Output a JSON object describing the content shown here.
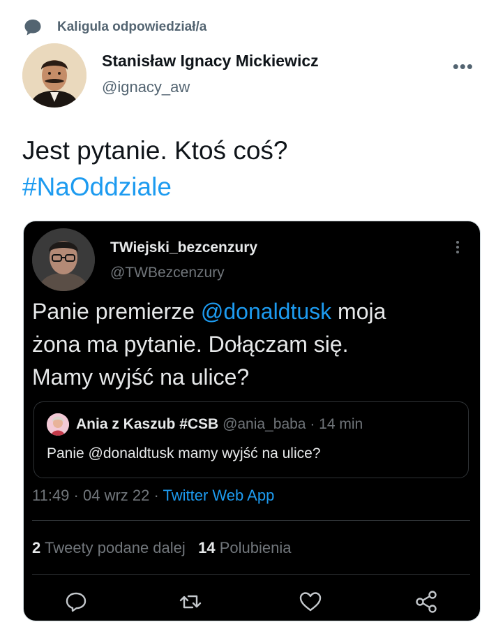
{
  "reply_context": {
    "icon": "speech-bubble-icon",
    "text": "Kaligula odpowiedział/a"
  },
  "author": {
    "name": "Stanisław Ignacy Mickiewicz",
    "handle": "@ignacy_aw",
    "more_icon": "more-horizontal-icon"
  },
  "tweet": {
    "text": "Jest pytanie. Ktoś coś?",
    "hashtag": "#NaOddziale"
  },
  "embedded": {
    "name": "TWiejski_bezcenzury",
    "handle": "@TWBezcenzury",
    "text_line1_pre": "Panie premierze ",
    "mention": "@donaldtusk",
    "text_line1_post": " moja",
    "text_line2": "żona ma pytanie. Dołączam się.",
    "text_line3": "Mamy wyjść na ulice?",
    "quote": {
      "name": "Ania z Kaszub #CSB",
      "handle": "@ania_baba",
      "separator": " · ",
      "time": "14 min",
      "text": "Panie @donaldtusk mamy wyjść na ulice?"
    },
    "time": "11:49",
    "sep1": " · ",
    "date": "04 wrz 22",
    "sep2": " · ",
    "app": "Twitter Web App",
    "retweets_count": "2",
    "retweets_label": " Tweety podane dalej",
    "likes_count": "14",
    "likes_label": " Polubienia"
  },
  "colors": {
    "accent": "#1d9bf0",
    "embed_bg": "#000000",
    "secondary_text": "#536471"
  }
}
